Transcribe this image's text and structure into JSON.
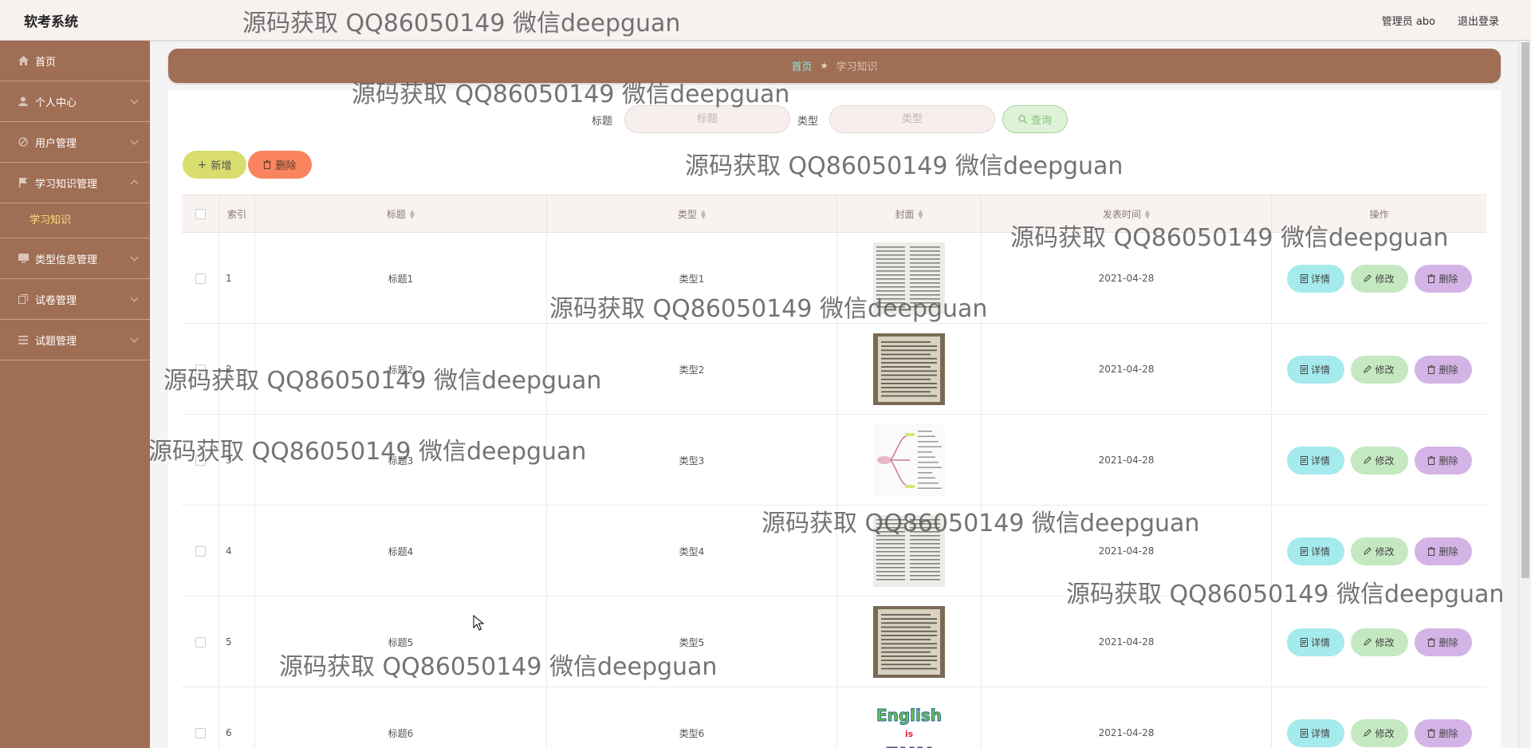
{
  "app": {
    "title": "软考系统"
  },
  "header": {
    "user": "管理员 abo",
    "logout": "退出登录"
  },
  "sidebar": {
    "items": [
      {
        "label": "首页",
        "icon": "home-icon"
      },
      {
        "label": "个人中心",
        "icon": "user-icon"
      },
      {
        "label": "用户管理",
        "icon": "users-icon"
      },
      {
        "label": "学习知识管理",
        "icon": "flag-icon",
        "expanded": true
      },
      {
        "label": "类型信息管理",
        "icon": "monitor-icon"
      },
      {
        "label": "试卷管理",
        "icon": "copy-icon"
      },
      {
        "label": "试题管理",
        "icon": "list-icon"
      }
    ],
    "sub_item": "学习知识"
  },
  "breadcrumb": {
    "home": "首页",
    "current": "学习知识"
  },
  "search": {
    "title_label": "标题",
    "title_placeholder": "标题",
    "type_label": "类型",
    "type_placeholder": "类型",
    "query": "查询"
  },
  "toolbar": {
    "add": "新增",
    "delete": "删除"
  },
  "table": {
    "headers": {
      "index": "索引",
      "title": "标题",
      "type": "类型",
      "cover": "封面",
      "time": "发表时间",
      "ops": "操作"
    },
    "rows": [
      {
        "index": "1",
        "title": "标题1",
        "type": "类型1",
        "cover": "text-page",
        "time": "2021-04-28"
      },
      {
        "index": "2",
        "title": "标题2",
        "type": "类型2",
        "cover": "photo-page",
        "time": "2021-04-28"
      },
      {
        "index": "3",
        "title": "标题3",
        "type": "类型3",
        "cover": "mindmap",
        "time": "2021-04-28"
      },
      {
        "index": "4",
        "title": "标题4",
        "type": "类型4",
        "cover": "text-page",
        "time": "2021-04-28"
      },
      {
        "index": "5",
        "title": "标题5",
        "type": "类型5",
        "cover": "photo-page",
        "time": "2021-04-28"
      },
      {
        "index": "6",
        "title": "标题6",
        "type": "类型6",
        "cover": "english-fun",
        "time": "2021-04-28"
      }
    ],
    "ops": {
      "detail": "详情",
      "edit": "修改",
      "delete": "删除"
    }
  },
  "watermark": "源码获取 QQ86050149 微信deepguan",
  "colors": {
    "sidebar": "#a06e54",
    "accent": "#ffe07a",
    "detail": "#a5eaec",
    "edit": "#c4e8c0",
    "delete": "#d4b3e6"
  }
}
